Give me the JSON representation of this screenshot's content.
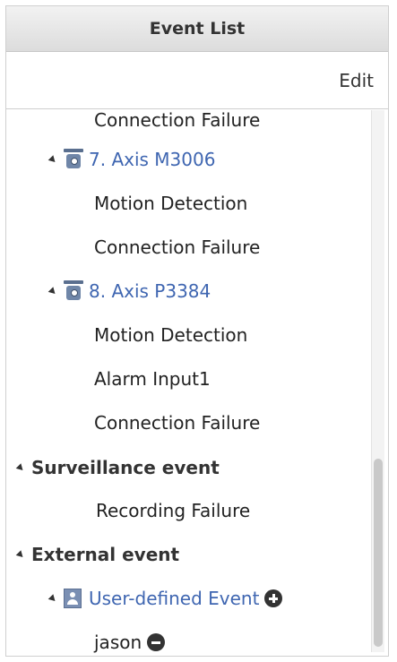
{
  "panel": {
    "title": "Event List",
    "edit_label": "Edit"
  },
  "tree": {
    "top_cutoff_item": "Connection Failure",
    "camera7": {
      "label": "7. Axis M3006",
      "children": [
        "Motion Detection",
        "Connection Failure"
      ]
    },
    "camera8": {
      "label": "8. Axis P3384",
      "children": [
        "Motion Detection",
        "Alarm Input1",
        "Connection Failure"
      ]
    },
    "surveillance": {
      "label": "Surveillance event",
      "children": [
        "Recording Failure"
      ]
    },
    "external": {
      "label": "External event",
      "user_defined": {
        "label": "User-defined Event",
        "children": [
          "jason"
        ]
      }
    }
  },
  "icons": [
    "expand-triangle-icon",
    "camera-icon",
    "user-icon",
    "add-icon",
    "remove-icon"
  ],
  "colors": {
    "link": "#3f66b1",
    "header_bg": "#e6e6e6",
    "text": "#222222"
  }
}
